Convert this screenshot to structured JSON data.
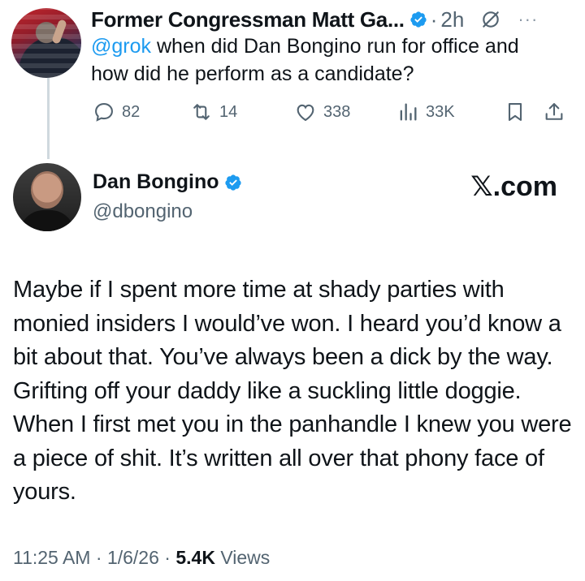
{
  "parent_tweet": {
    "author_name": "Former Congressman Matt Ga...",
    "separator": "·",
    "time": "2h",
    "more_label": "···",
    "mention": "@grok",
    "text": " when did Dan Bongino run for office and how did he perform as a candidate?",
    "replies": "82",
    "reposts": "14",
    "likes": "338",
    "views": "33K"
  },
  "main_tweet": {
    "author_name": "Dan Bongino",
    "handle": "@dbongino",
    "brand": "𝕏.com",
    "text": "Maybe if I spent more time at shady parties with monied insiders I would’ve won. I heard you’d know a bit about that. You’ve always been a dick by the way. Grifting off your daddy like a suckling little doggie. When I first met you in the panhandle I knew you were a piece of shit. It’s written all over that phony face of yours.",
    "time": "11:25 AM",
    "date": "1/6/26",
    "views_count": "5.4K",
    "views_label": "Views",
    "dot": "·"
  },
  "colors": {
    "verified": "#1d9bf0",
    "link": "#1d9bf0",
    "secondary_text": "#536471",
    "thread_line": "#cfd9de"
  },
  "icons": [
    "verified-badge-icon",
    "grok-icon",
    "more-icon",
    "reply-icon",
    "repost-icon",
    "like-icon",
    "views-icon",
    "bookmark-icon",
    "share-icon"
  ]
}
